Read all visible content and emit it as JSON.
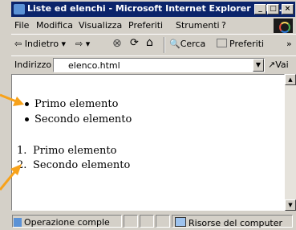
{
  "window": {
    "title": "Liste ed elenchi - Microsoft Internet Explorer - [N...",
    "btn_min": "_",
    "btn_max": "□",
    "btn_close": "×"
  },
  "menu": {
    "items": [
      "File",
      "Modifica",
      "Visualizza",
      "Preferiti",
      "Strumenti",
      "?"
    ]
  },
  "toolbar": {
    "back": "⇦ Indietro ▾",
    "forward": "⇨ ▾",
    "stop": "⊗",
    "refresh": "⟳",
    "home": "⌂",
    "search": "Cerca",
    "favorites": "Preferiti",
    "more": "»"
  },
  "address": {
    "label": "Indirizzo",
    "value": "elenco.html",
    "go": "Vai"
  },
  "content": {
    "unordered": [
      "Primo elemento",
      "Secondo elemento"
    ],
    "ordered_numbers": [
      "1.",
      "2."
    ],
    "ordered": [
      "Primo elemento",
      "Secondo elemento"
    ]
  },
  "status": {
    "text": "Operazione comple",
    "zone": "Risorse del computer"
  },
  "colors": {
    "titlebar": "#0b246b",
    "callout_arrow": "#f7a21b"
  }
}
